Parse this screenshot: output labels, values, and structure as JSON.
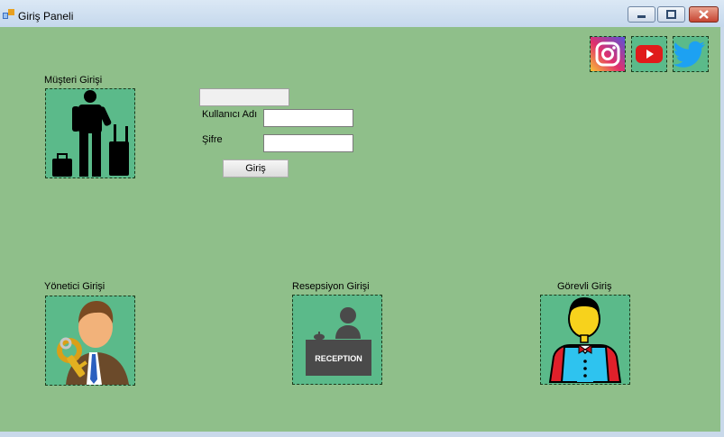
{
  "window": {
    "title": "Giriş Paneli"
  },
  "social": {
    "items": [
      "instagram-icon",
      "youtube-icon",
      "twitter-icon"
    ]
  },
  "login": {
    "musteri_label": "Müşteri Girişi",
    "username_label": "Kullanıcı Adı",
    "password_label": "Şifre",
    "username_value": "",
    "password_value": "",
    "top_field_value": "",
    "submit_label": "Giriş"
  },
  "roles": {
    "yonetici_label": "Yönetici Girişi",
    "resepsiyon_label": "Resepsiyon Girişi",
    "reception_sign": "RECEPTION",
    "gorevli_label": "Görevli Giriş"
  },
  "colors": {
    "form_background": "#8fbf8a",
    "picture_background": "#5bba8a"
  }
}
